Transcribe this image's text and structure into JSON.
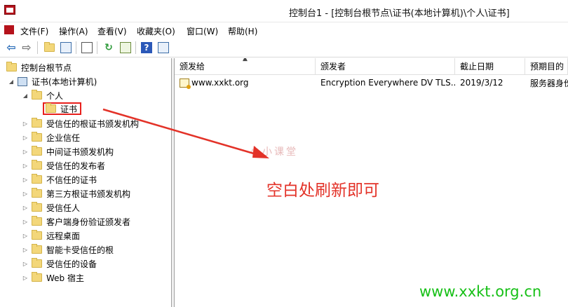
{
  "window": {
    "title": "控制台1 - [控制台根节点\\证书(本地计算机)\\个人\\证书]"
  },
  "menu": [
    "文件(F)",
    "操作(A)",
    "查看(V)",
    "收藏夹(O)",
    "窗口(W)",
    "帮助(H)"
  ],
  "tree": {
    "root": "控制台根节点",
    "store": "证书(本地计算机)",
    "personal": "个人",
    "selected": "证书",
    "items": [
      "受信任的根证书颁发机构",
      "企业信任",
      "中间证书颁发机构",
      "受信任的发布者",
      "不信任的证书",
      "第三方根证书颁发机构",
      "受信任人",
      "客户端身份验证颁发者",
      "远程桌面",
      "智能卡受信任的根",
      "受信任的设备",
      "Web 宿主"
    ]
  },
  "list": {
    "columns": [
      "颁发给",
      "颁发者",
      "截止日期",
      "预期目的"
    ],
    "rows": [
      {
        "issued_to": "www.xxkt.org",
        "issuer": "Encryption Everywhere DV TLS...",
        "expiry": "2019/3/12",
        "purpose": "服务器身份"
      }
    ]
  },
  "annotation": "空白处刷新即可",
  "watermark": "小小课堂",
  "site_url": "www.xxkt.org.cn",
  "colors": {
    "annotation_red": "#e33228",
    "url_green": "#17c017",
    "folder_yellow": "#f3d77a"
  }
}
